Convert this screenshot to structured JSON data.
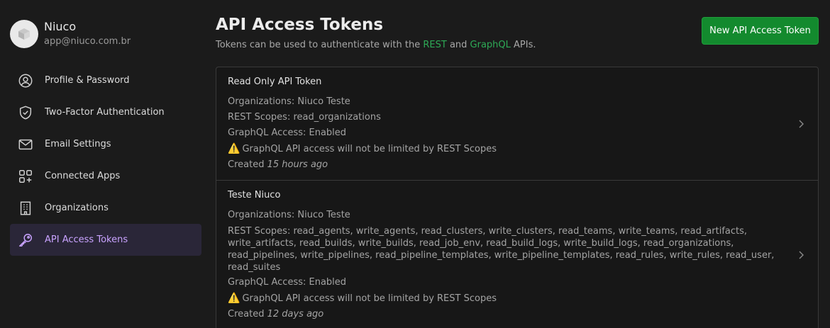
{
  "user": {
    "name": "Niuco",
    "email": "app@niuco.com.br"
  },
  "nav": [
    {
      "label": "Profile & Password",
      "icon": "user-circle-icon"
    },
    {
      "label": "Two-Factor Authentication",
      "icon": "shield-check-icon"
    },
    {
      "label": "Email Settings",
      "icon": "envelope-icon"
    },
    {
      "label": "Connected Apps",
      "icon": "apps-grid-icon"
    },
    {
      "label": "Organizations",
      "icon": "building-icon"
    },
    {
      "label": "API Access Tokens",
      "icon": "key-icon",
      "active": true
    }
  ],
  "main": {
    "title": "API Access Tokens",
    "subtitle_prefix": "Tokens can be used to authenticate with the ",
    "rest_link": "REST",
    "subtitle_and": " and ",
    "graphql_link": "GraphQL",
    "subtitle_suffix": " APIs.",
    "new_button": "New API Access Token"
  },
  "tokens": [
    {
      "name": "Read Only API Token",
      "organizations": "Organizations: Niuco Teste",
      "scopes": "REST Scopes: read_organizations",
      "graphql": "GraphQL Access: Enabled",
      "warning": "GraphQL API access will not be limited by REST Scopes",
      "created_prefix": "Created ",
      "created_ago": "15 hours ago"
    },
    {
      "name": "Teste Niuco",
      "organizations": "Organizations: Niuco Teste",
      "scopes": "REST Scopes: read_agents, write_agents, read_clusters, write_clusters, read_teams, write_teams, read_artifacts, write_artifacts, read_builds, write_builds, read_job_env, read_build_logs, write_build_logs, read_organizations, read_pipelines, write_pipelines, read_pipeline_templates, write_pipeline_templates, read_rules, write_rules, read_user, read_suites",
      "graphql": "GraphQL Access: Enabled",
      "warning": "GraphQL API access will not be limited by REST Scopes",
      "created_prefix": "Created ",
      "created_ago": "12 days ago"
    }
  ],
  "colors": {
    "accent_green": "#138a2e",
    "link_green": "#2eaa56",
    "active_purple": "#c9a3ff"
  }
}
